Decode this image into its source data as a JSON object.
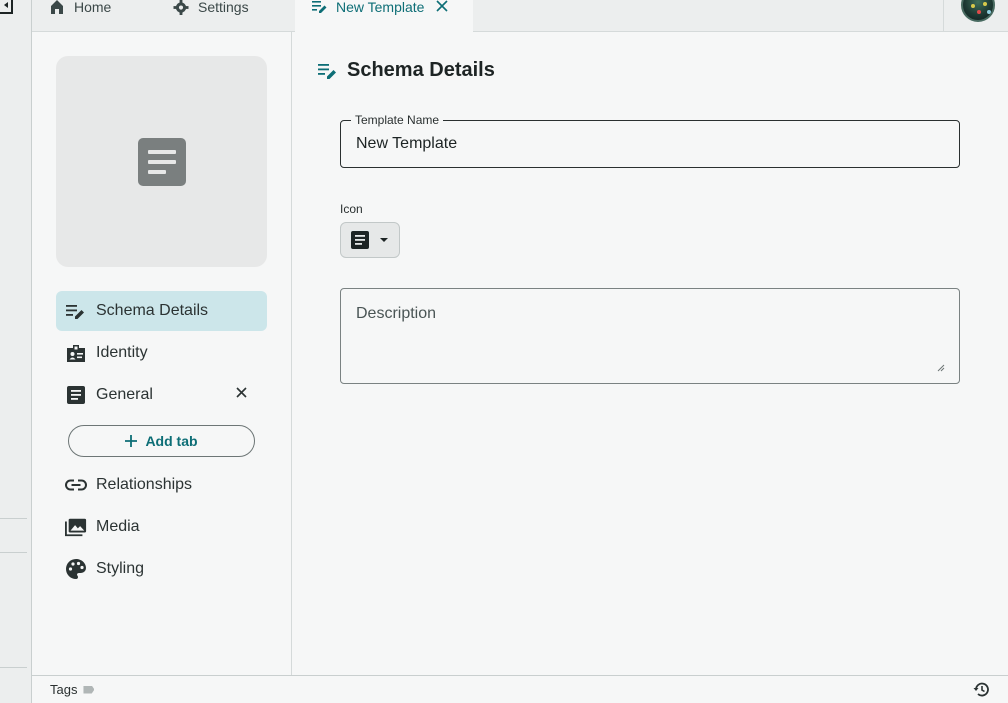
{
  "tabs": [
    {
      "label": "Home",
      "icon": "home-icon"
    },
    {
      "label": "Settings",
      "icon": "gear-icon"
    },
    {
      "label": "New Template",
      "icon": "edit-note-icon",
      "active": true
    }
  ],
  "sidebar": {
    "preview_icon": "document-icon",
    "items": [
      {
        "label": "Schema Details",
        "icon": "edit-note-icon",
        "active": true
      },
      {
        "label": "Identity",
        "icon": "id-badge-icon"
      },
      {
        "label": "General",
        "icon": "document-icon",
        "removable": true
      },
      {
        "label": "Relationships",
        "icon": "link-icon"
      },
      {
        "label": "Media",
        "icon": "photo-library-icon"
      },
      {
        "label": "Styling",
        "icon": "palette-icon"
      }
    ],
    "add_tab_label": "Add tab"
  },
  "main": {
    "title": "Schema Details",
    "template_name": {
      "label": "Template Name",
      "value": "New Template"
    },
    "icon_field": {
      "label": "Icon",
      "selected": "document-icon"
    },
    "description": {
      "placeholder": "Description",
      "value": ""
    }
  },
  "footer": {
    "tags_label": "Tags"
  },
  "colors": {
    "accent": "#0d6e76",
    "active_nav_bg": "#cce6ea",
    "background": "#f6f7f7"
  }
}
